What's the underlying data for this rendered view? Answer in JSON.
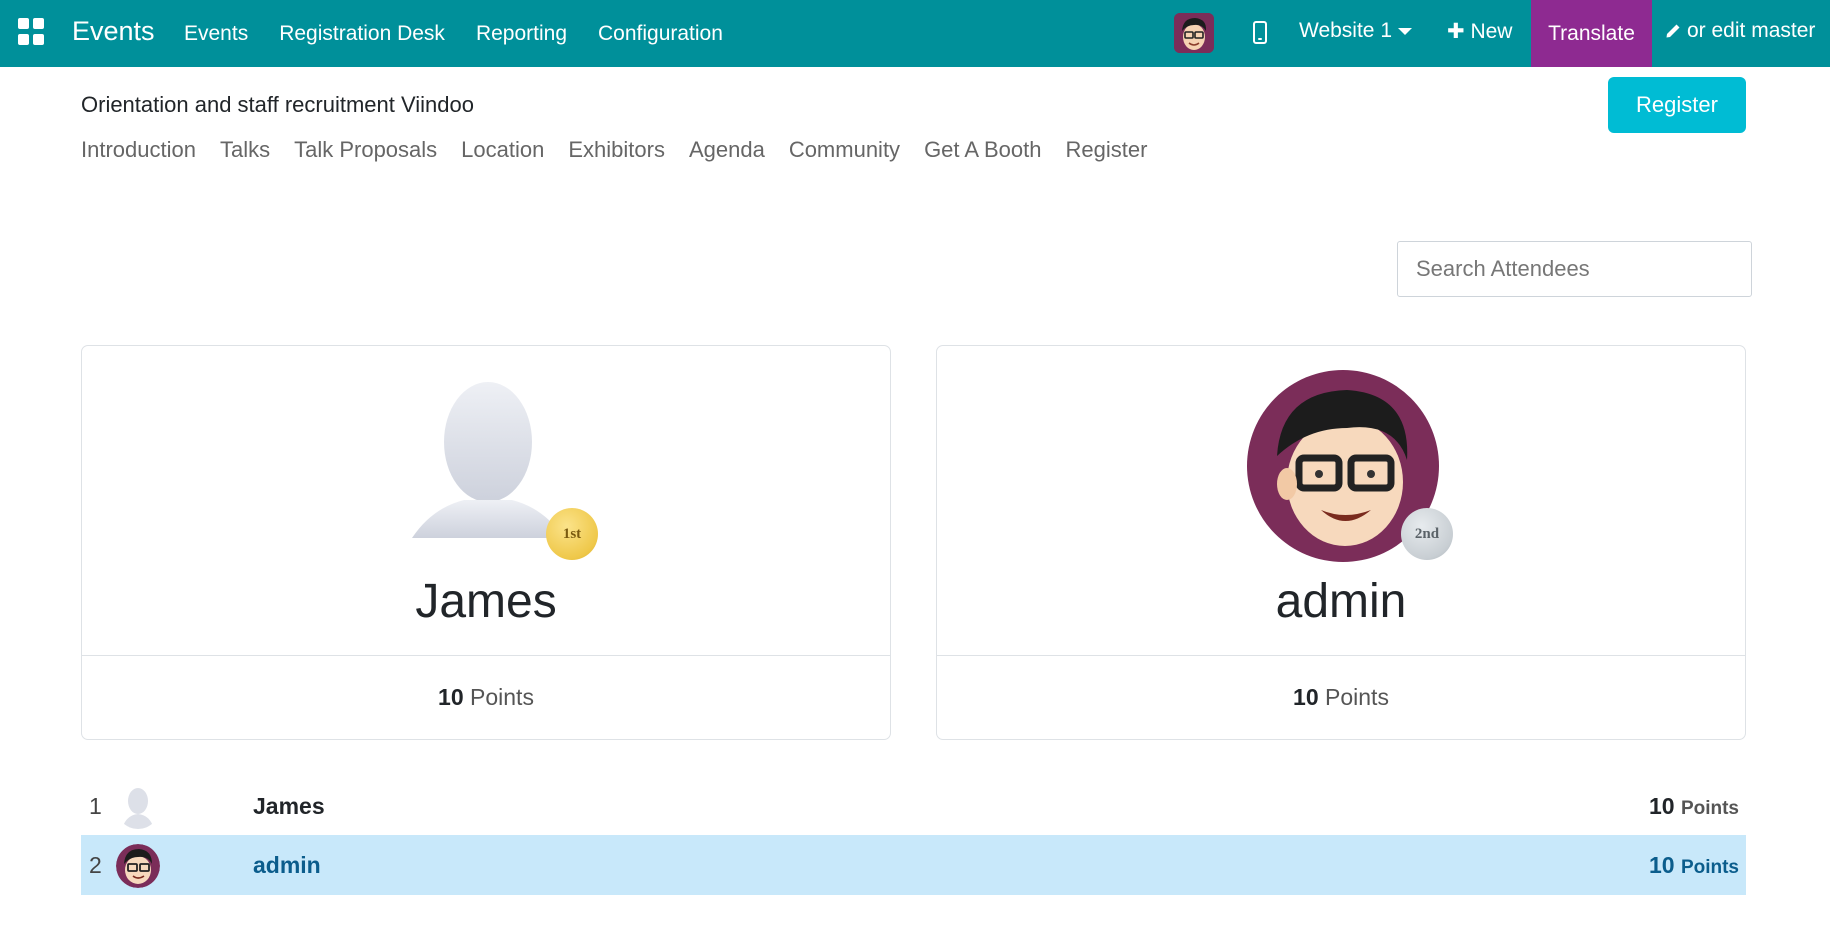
{
  "topbar": {
    "app_title": "Events",
    "nav": [
      "Events",
      "Registration Desk",
      "Reporting",
      "Configuration"
    ],
    "website": "Website 1",
    "new_label": "New",
    "translate_label": "Translate",
    "edit_label": "or edit master",
    "colors": {
      "bar": "#00909a",
      "translate": "#8e2a91"
    }
  },
  "event": {
    "title": "Orientation and staff recruitment Viindoo",
    "register_label": "Register",
    "tabs": [
      "Introduction",
      "Talks",
      "Talk Proposals",
      "Location",
      "Exhibitors",
      "Agenda",
      "Community",
      "Get A Booth",
      "Register"
    ]
  },
  "search": {
    "placeholder": "Search Attendees"
  },
  "podium": [
    {
      "name": "James",
      "medal": "1st",
      "points": "10",
      "points_label": "Points",
      "avatar": "default-person-icon"
    },
    {
      "name": "admin",
      "medal": "2nd",
      "points": "10",
      "points_label": "Points",
      "avatar": "cartoon-avatar"
    }
  ],
  "leaderboard": [
    {
      "rank": "1",
      "name": "James",
      "points": "10",
      "points_label": "Points"
    },
    {
      "rank": "2",
      "name": "admin",
      "points": "10",
      "points_label": "Points"
    }
  ]
}
